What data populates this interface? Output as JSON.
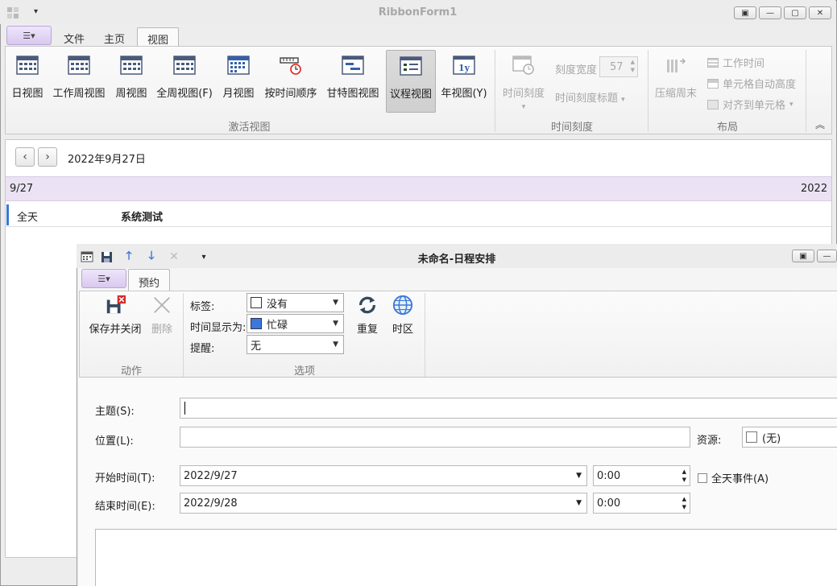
{
  "window": {
    "title": "RibbonForm1",
    "buttons": [
      "▣",
      "—",
      "▢",
      "✕"
    ]
  },
  "tabs": [
    "文件",
    "主页",
    "视图"
  ],
  "active_tab": "视图",
  "ribbon": {
    "activate_view": {
      "label": "激活视图",
      "buttons": [
        "日视图",
        "工作周视图",
        "周视图",
        "全周视图(F)",
        "月视图",
        "按时间顺序",
        "甘特图视图",
        "议程视图",
        "年视图(Y)"
      ]
    },
    "time_scale": {
      "label": "时间刻度",
      "time_scale_btn": "时间刻度",
      "scale_width_label": "刻度宽度",
      "scale_width_value": "57",
      "scale_title": "时间刻度标题"
    },
    "layout": {
      "label": "布局",
      "compress_weekend": "压缩周末",
      "work_time": "工作时间",
      "cell_auto_height": "单元格自动高度",
      "snap_to_cell": "对齐到单元格"
    }
  },
  "scheduler": {
    "date": "2022年9月27日",
    "day_short": "9/27",
    "year": "2022",
    "allday_label": "全天",
    "appointment": "系统测试"
  },
  "dialog": {
    "title": "未命名-日程安排",
    "tab": "预约",
    "actions": {
      "label": "动作",
      "save_close": "保存并关闭",
      "delete": "删除"
    },
    "options": {
      "label": "选项",
      "tag_label": "标签:",
      "tag_value": "没有",
      "show_as_label": "时间显示为:",
      "show_as_value": "忙碌",
      "reminder_label": "提醒:",
      "reminder_value": "无",
      "recurrence": "重复",
      "timezone": "时区"
    },
    "form": {
      "subject_label": "主题(S):",
      "subject_value": "",
      "location_label": "位置(L):",
      "location_value": "",
      "resource_label": "资源:",
      "resource_value": "(无)",
      "start_label": "开始时间(T):",
      "start_date": "2022/9/27",
      "start_time": "0:00",
      "allday_event": "全天事件(A)",
      "end_label": "结束时间(E):",
      "end_date": "2022/9/28",
      "end_time": "0:00"
    }
  },
  "colors": {
    "busy": "#3b78d8",
    "ribbon_selected": "#d4d4d4",
    "day_header": "#ebe3f4"
  }
}
